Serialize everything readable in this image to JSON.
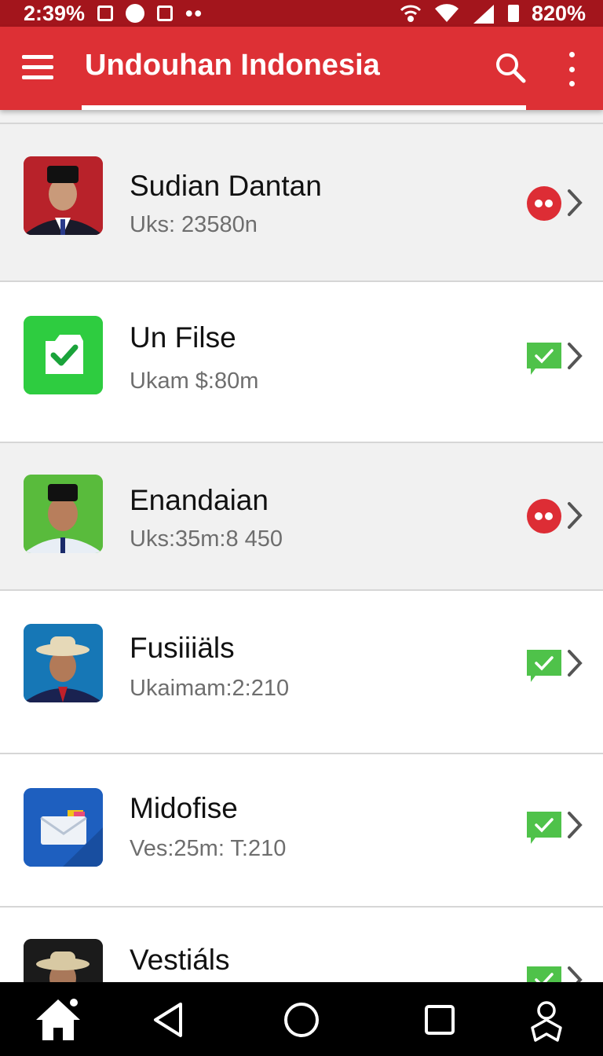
{
  "status_bar": {
    "time": "2:39%",
    "battery": "820%",
    "icons": [
      "image-icon",
      "location-icon",
      "gallery-icon",
      "more-dots-icon",
      "hotspot-icon",
      "wifi-icon",
      "signal-icon",
      "battery-icon"
    ]
  },
  "app_bar": {
    "title": "Undouhan Indonesia",
    "icons": [
      "menu-icon",
      "search-icon",
      "more-vert-icon"
    ]
  },
  "list": [
    {
      "title": "Sudian Dantan",
      "subtitle": "Uks: 23580n",
      "status": "red-dots",
      "thumb": "portrait-peci-red"
    },
    {
      "title": "Un Filse",
      "subtitle": "Ukam $:80m",
      "status": "green-check",
      "thumb": "green-check-app"
    },
    {
      "title": "Enandaian",
      "subtitle": "Uks:35m:8 450",
      "status": "red-dots",
      "thumb": "portrait-peci-green"
    },
    {
      "title": "Fusiiiäls",
      "subtitle": "Ukaimam:2:210",
      "status": "green-check",
      "thumb": "portrait-hat-blue"
    },
    {
      "title": "Midofise",
      "subtitle": "Ves:25m: T:210",
      "status": "green-check",
      "thumb": "mail-app"
    },
    {
      "title": "Vestiáls",
      "subtitle": "",
      "status": "green-check",
      "thumb": "portrait-hat-dark"
    }
  ],
  "colors": {
    "status_bar": "#a3151c",
    "app_bar": "#dd3035",
    "badge_red": "#dd2d35",
    "badge_green": "#4fc24a"
  },
  "nav_bar": {
    "icons": [
      "home-icon",
      "back-icon",
      "home-circle-icon",
      "recents-icon",
      "profile-star-icon"
    ]
  }
}
